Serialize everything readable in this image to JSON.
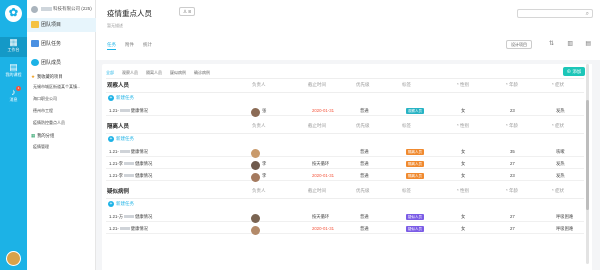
{
  "org": {
    "name": "科技有限公司 (225)"
  },
  "rail": [
    {
      "label": "工作台",
      "icon": "grid-icon"
    },
    {
      "label": "我的课程",
      "icon": "book-icon"
    },
    {
      "label": "消息",
      "icon": "bell-icon",
      "badge": "1"
    }
  ],
  "side": {
    "menu": [
      "团队项目",
      "团队任务",
      "团队成员"
    ],
    "starred_title": "我收藏的项目",
    "starred_items": [
      "无锡市城区街道某个某镇...",
      "海口职业公司",
      "德州市工程",
      "疫情防控重点人员"
    ],
    "mine_title": "我的分组",
    "mine_items": [
      "疫情管理"
    ]
  },
  "header": {
    "title": "疫情重点人员",
    "people": "8",
    "subtitle": "暂无描述",
    "tabs": [
      "任务",
      "附件",
      "统计"
    ],
    "project_settings": "设计项目"
  },
  "content": {
    "tabs": [
      "全部",
      "观察人员",
      "隔离人员",
      "疑似病例",
      "确诊病例"
    ],
    "add_button": "添加",
    "columns": [
      "负责人",
      "截止时间",
      "优先级",
      "标签",
      "* 性别",
      "* 年龄",
      "* 症状"
    ],
    "add_task": "新建任务",
    "groups": [
      {
        "name": "观察人员",
        "rows": [
          {
            "task": "1.21-",
            "task_suffix": "健康情况",
            "owner": "张",
            "due": "2020-01-31",
            "due_red": true,
            "priority": "普通",
            "tag": "观察人员",
            "tag_color": "#27b3c4",
            "gender": "女",
            "age": "23",
            "symptom": "发热"
          }
        ]
      },
      {
        "name": "隔离人员",
        "rows": [
          {
            "task": "1.21-",
            "task_suffix": "健康情况",
            "owner": "",
            "due": "",
            "due_red": false,
            "priority": "普通",
            "tag": "隔离人员",
            "tag_color": "#f08a2f",
            "gender": "女",
            "age": "35",
            "symptom": "咳嗽"
          },
          {
            "task": "1.21-李",
            "task_suffix": "健康情况",
            "owner": "李",
            "due": "按天循环",
            "due_red": false,
            "priority": "普通",
            "tag": "隔离人员",
            "tag_color": "#f08a2f",
            "gender": "女",
            "age": "27",
            "symptom": "发热"
          },
          {
            "task": "1.21-李",
            "task_suffix": "健康情况",
            "owner": "李",
            "due": "2020-01-31",
            "due_red": true,
            "priority": "普通",
            "tag": "隔离人员",
            "tag_color": "#f08a2f",
            "gender": "女",
            "age": "23",
            "symptom": "发热"
          }
        ]
      },
      {
        "name": "疑似病例",
        "rows": [
          {
            "task": "1.21-方",
            "task_suffix": "健康情况",
            "owner": "",
            "due": "按天循环",
            "due_red": false,
            "priority": "普通",
            "tag": "疑似人员",
            "tag_color": "#7b5ce6",
            "gender": "女",
            "age": "27",
            "symptom": "呼吸困难"
          },
          {
            "task": "1.21-",
            "task_suffix": "健康情况",
            "owner": "",
            "due": "2020-01-31",
            "due_red": true,
            "priority": "普通",
            "tag": "疑似人员",
            "tag_color": "#7b5ce6",
            "gender": "女",
            "age": "27",
            "symptom": "呼吸困难"
          }
        ]
      }
    ]
  }
}
